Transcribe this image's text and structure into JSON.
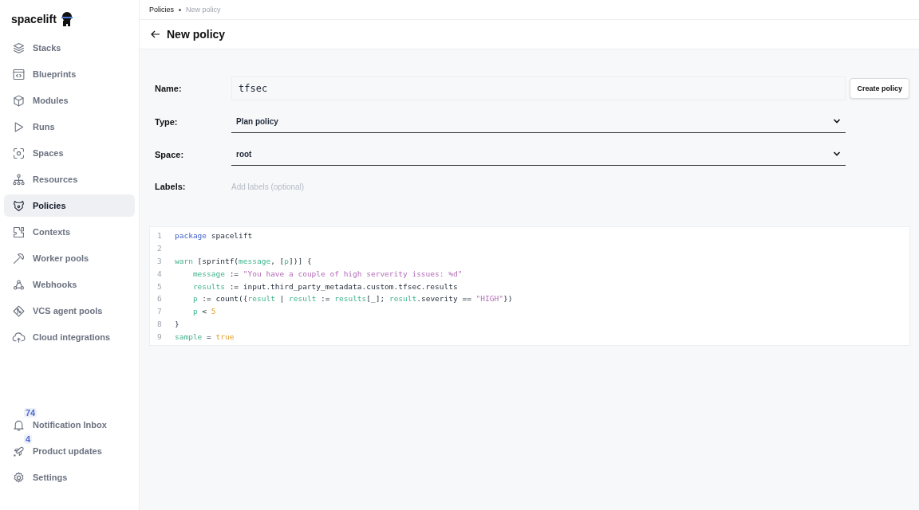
{
  "sidebar": {
    "logo": "spacelift",
    "items": [
      {
        "label": "Stacks",
        "selected": false
      },
      {
        "label": "Blueprints",
        "selected": false
      },
      {
        "label": "Modules",
        "selected": false
      },
      {
        "label": "Runs",
        "selected": false
      },
      {
        "label": "Spaces",
        "selected": false
      },
      {
        "label": "Resources",
        "selected": false
      },
      {
        "label": "Policies",
        "selected": true
      },
      {
        "label": "Contexts",
        "selected": false
      },
      {
        "label": "Worker pools",
        "selected": false
      },
      {
        "label": "Webhooks",
        "selected": false
      },
      {
        "label": "VCS agent pools",
        "selected": false
      },
      {
        "label": "Cloud integrations",
        "selected": false
      }
    ],
    "bottom_items": [
      {
        "label": "Notification Inbox",
        "badge": "74"
      },
      {
        "label": "Product updates",
        "badge": "4"
      },
      {
        "label": "Settings"
      }
    ]
  },
  "breadcrumbs": [
    "Policies",
    "New policy"
  ],
  "page_title": "New policy",
  "form": {
    "name_label": "Name:",
    "name_value": "tfsec",
    "type_label": "Type:",
    "type_value": "Plan policy",
    "space_label": "Space:",
    "space_value": "root",
    "labels_label": "Labels:",
    "labels_placeholder": "Add labels (optional)",
    "create_button": "Create policy"
  },
  "code": {
    "lines": [
      {
        "number": "1",
        "tokens": [
          {
            "text": "package",
            "kind": "keyword"
          },
          {
            "text": " spacelift",
            "kind": "plain"
          }
        ]
      },
      {
        "number": "2"
      },
      {
        "number": "3",
        "tokens": [
          {
            "text": "warn",
            "kind": "var"
          },
          {
            "text": " [sprintf(",
            "kind": "plain"
          },
          {
            "text": "message",
            "kind": "var"
          },
          {
            "text": ", [",
            "kind": "plain"
          },
          {
            "text": "p",
            "kind": "var"
          },
          {
            "text": "])] {",
            "kind": "plain"
          }
        ]
      },
      {
        "number": "4",
        "indented": true,
        "tokens": [
          {
            "text": "message",
            "kind": "var"
          },
          {
            "text": " := ",
            "kind": "plain"
          },
          {
            "text": "\"You have a couple of high serverity issues: %d\"",
            "kind": "string"
          }
        ]
      },
      {
        "number": "5",
        "indented": true,
        "tokens": [
          {
            "text": "results",
            "kind": "var"
          },
          {
            "text": " := input.third_party_metadata.custom.tfsec.results",
            "kind": "plain"
          }
        ]
      },
      {
        "number": "6",
        "indented": true,
        "tokens": [
          {
            "text": "p",
            "kind": "var"
          },
          {
            "text": " := count({",
            "kind": "plain"
          },
          {
            "text": "result",
            "kind": "var"
          },
          {
            "text": " | ",
            "kind": "plain"
          },
          {
            "text": "result",
            "kind": "var"
          },
          {
            "text": " := ",
            "kind": "plain"
          },
          {
            "text": "results",
            "kind": "var"
          },
          {
            "text": "[_]; ",
            "kind": "plain"
          },
          {
            "text": "result",
            "kind": "var"
          },
          {
            "text": ".severity == ",
            "kind": "plain"
          },
          {
            "text": "\"HIGH\"",
            "kind": "string"
          },
          {
            "text": "})",
            "kind": "plain"
          }
        ]
      },
      {
        "number": "7",
        "indented": true,
        "tokens": [
          {
            "text": "p",
            "kind": "var"
          },
          {
            "text": " < ",
            "kind": "plain"
          },
          {
            "text": "5",
            "kind": "number"
          }
        ]
      },
      {
        "number": "8",
        "tokens": [
          {
            "text": "}",
            "kind": "plain"
          }
        ]
      },
      {
        "number": "9",
        "tokens": [
          {
            "text": "sample",
            "kind": "var"
          },
          {
            "text": " = ",
            "kind": "plain"
          },
          {
            "text": "true",
            "kind": "number"
          }
        ]
      }
    ]
  }
}
